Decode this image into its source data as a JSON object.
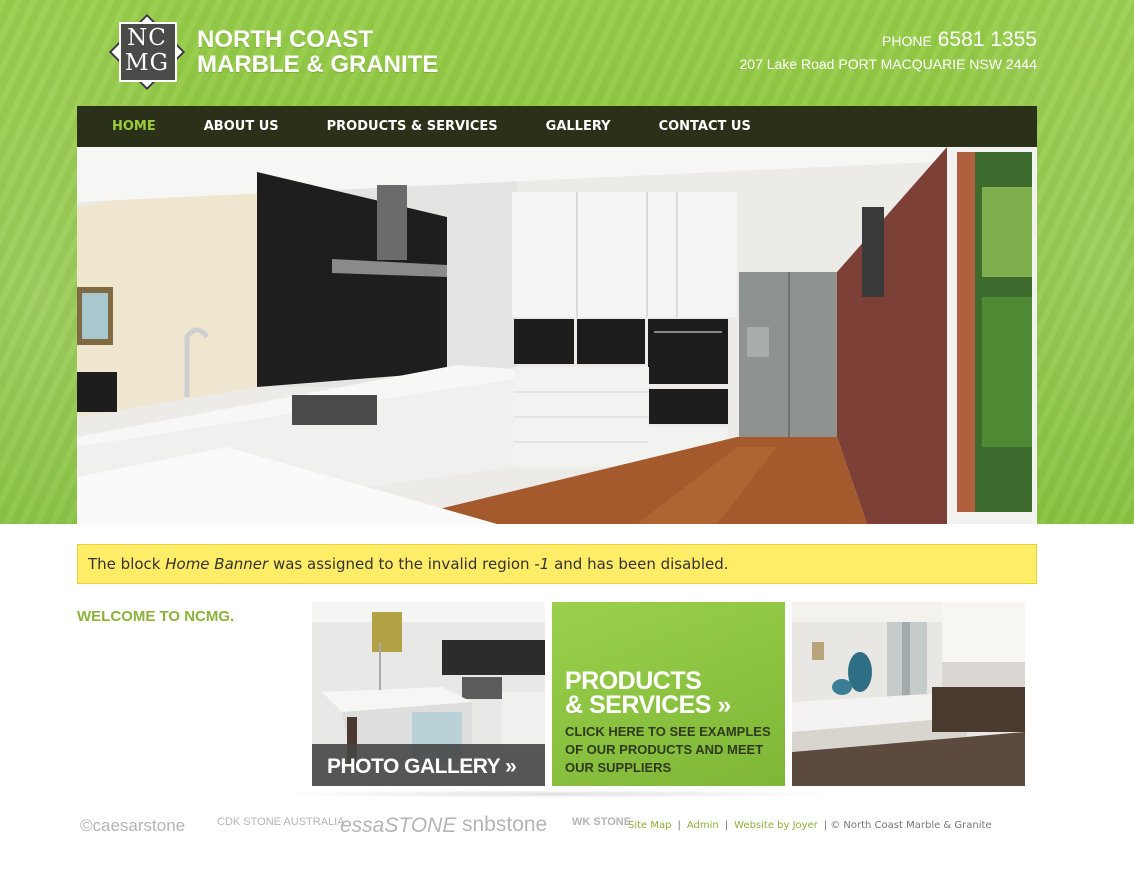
{
  "header": {
    "logo_letters_top": "NC",
    "logo_letters_bottom": "MG",
    "company_line1": "NORTH COAST",
    "company_line2": "MARBLE & GRANITE",
    "phone_label": "PHONE",
    "phone_number": "6581 1355",
    "address": "207 Lake Road PORT MACQUARIE NSW 2444"
  },
  "nav": {
    "items": [
      {
        "label": "HOME",
        "active": true
      },
      {
        "label": "ABOUT US",
        "active": false
      },
      {
        "label": "PRODUCTS & SERVICES",
        "active": false
      },
      {
        "label": "GALLERY",
        "active": false
      },
      {
        "label": "CONTACT US",
        "active": false
      }
    ]
  },
  "message": {
    "part1": "The block ",
    "block_name": "Home Banner",
    "part2": " was assigned to the invalid region ",
    "region": "-1",
    "part3": " and has been disabled."
  },
  "welcome": "WELCOME TO NCMG.",
  "tiles": {
    "gallery_caption": "PHOTO GALLERY »",
    "products_title_line1": "PRODUCTS",
    "products_title_line2": "& SERVICES »",
    "products_subtitle": "CLICK HERE TO SEE EXAMPLES OF OUR PRODUCTS AND MEET OUR SUPPLIERS"
  },
  "suppliers": [
    "©caesarstone",
    "CDK STONE AUSTRALIA",
    "essaSTONE",
    "snbstone",
    "WK STONE"
  ],
  "footer": {
    "site_map": "Site Map",
    "admin": "Admin",
    "website_by": "Website by Joyer",
    "copyright": "© North Coast Marble & Granite"
  },
  "colors": {
    "brand_green": "#8cc63f",
    "nav_bg": "#2b3119",
    "nav_active": "#9ccb3b",
    "message_bg": "#ffec67"
  }
}
